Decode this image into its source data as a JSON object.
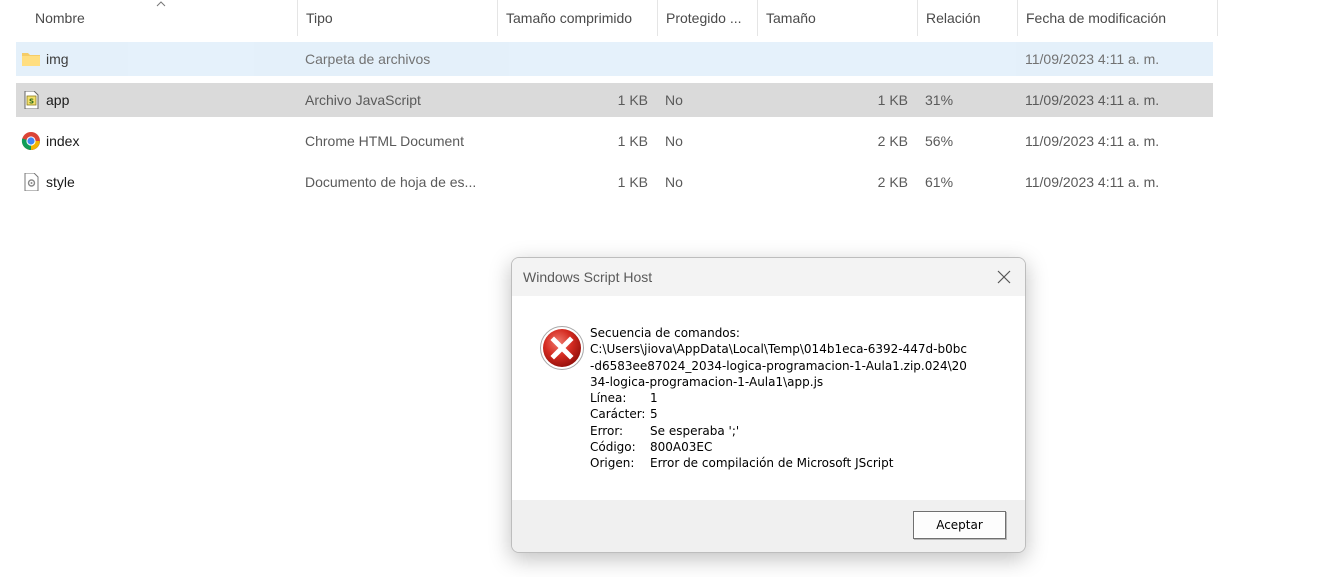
{
  "columns": {
    "name": "Nombre",
    "type": "Tipo",
    "compressed": "Tamaño comprimido",
    "protected": "Protegido ...",
    "size": "Tamaño",
    "ratio": "Relación",
    "modified": "Fecha de modificación"
  },
  "files": [
    {
      "name": "img",
      "type": "Carpeta de archivos",
      "compressed": "",
      "protected": "",
      "size": "",
      "ratio": "",
      "modified": "11/09/2023 4:11 a. m.",
      "icon": "folder-icon"
    },
    {
      "name": "app",
      "type": "Archivo JavaScript",
      "compressed": "1 KB",
      "protected": "No",
      "size": "1 KB",
      "ratio": "31%",
      "modified": "11/09/2023 4:11 a. m.",
      "icon": "javascript-file-icon"
    },
    {
      "name": "index",
      "type": "Chrome HTML Document",
      "compressed": "1 KB",
      "protected": "No",
      "size": "2 KB",
      "ratio": "56%",
      "modified": "11/09/2023 4:11 a. m.",
      "icon": "chrome-icon"
    },
    {
      "name": "style",
      "type": "Documento de hoja de es...",
      "compressed": "1 KB",
      "protected": "No",
      "size": "2 KB",
      "ratio": "61%",
      "modified": "11/09/2023 4:11 a. m.",
      "icon": "css-file-icon"
    }
  ],
  "dialog": {
    "title": "Windows Script Host",
    "heading": "Secuencia de comandos:",
    "path_lines": [
      "C:\\Users\\jiova\\AppData\\Local\\Temp\\014b1eca-6392-447d-b0bc",
      "-d6583ee87024_2034-logica-programacion-1-Aula1.zip.024\\20",
      "34-logica-programacion-1-Aula1\\app.js"
    ],
    "fields": [
      {
        "label": "Línea:",
        "value": "1"
      },
      {
        "label": "Carácter:",
        "value": "5"
      },
      {
        "label": "Error:",
        "value": "Se esperaba ';'"
      },
      {
        "label": "Código:",
        "value": "800A03EC"
      },
      {
        "label": "Origen:",
        "value": "Error de compilación de Microsoft JScript"
      }
    ],
    "ok_label": "Aceptar",
    "icon": "error-icon"
  }
}
